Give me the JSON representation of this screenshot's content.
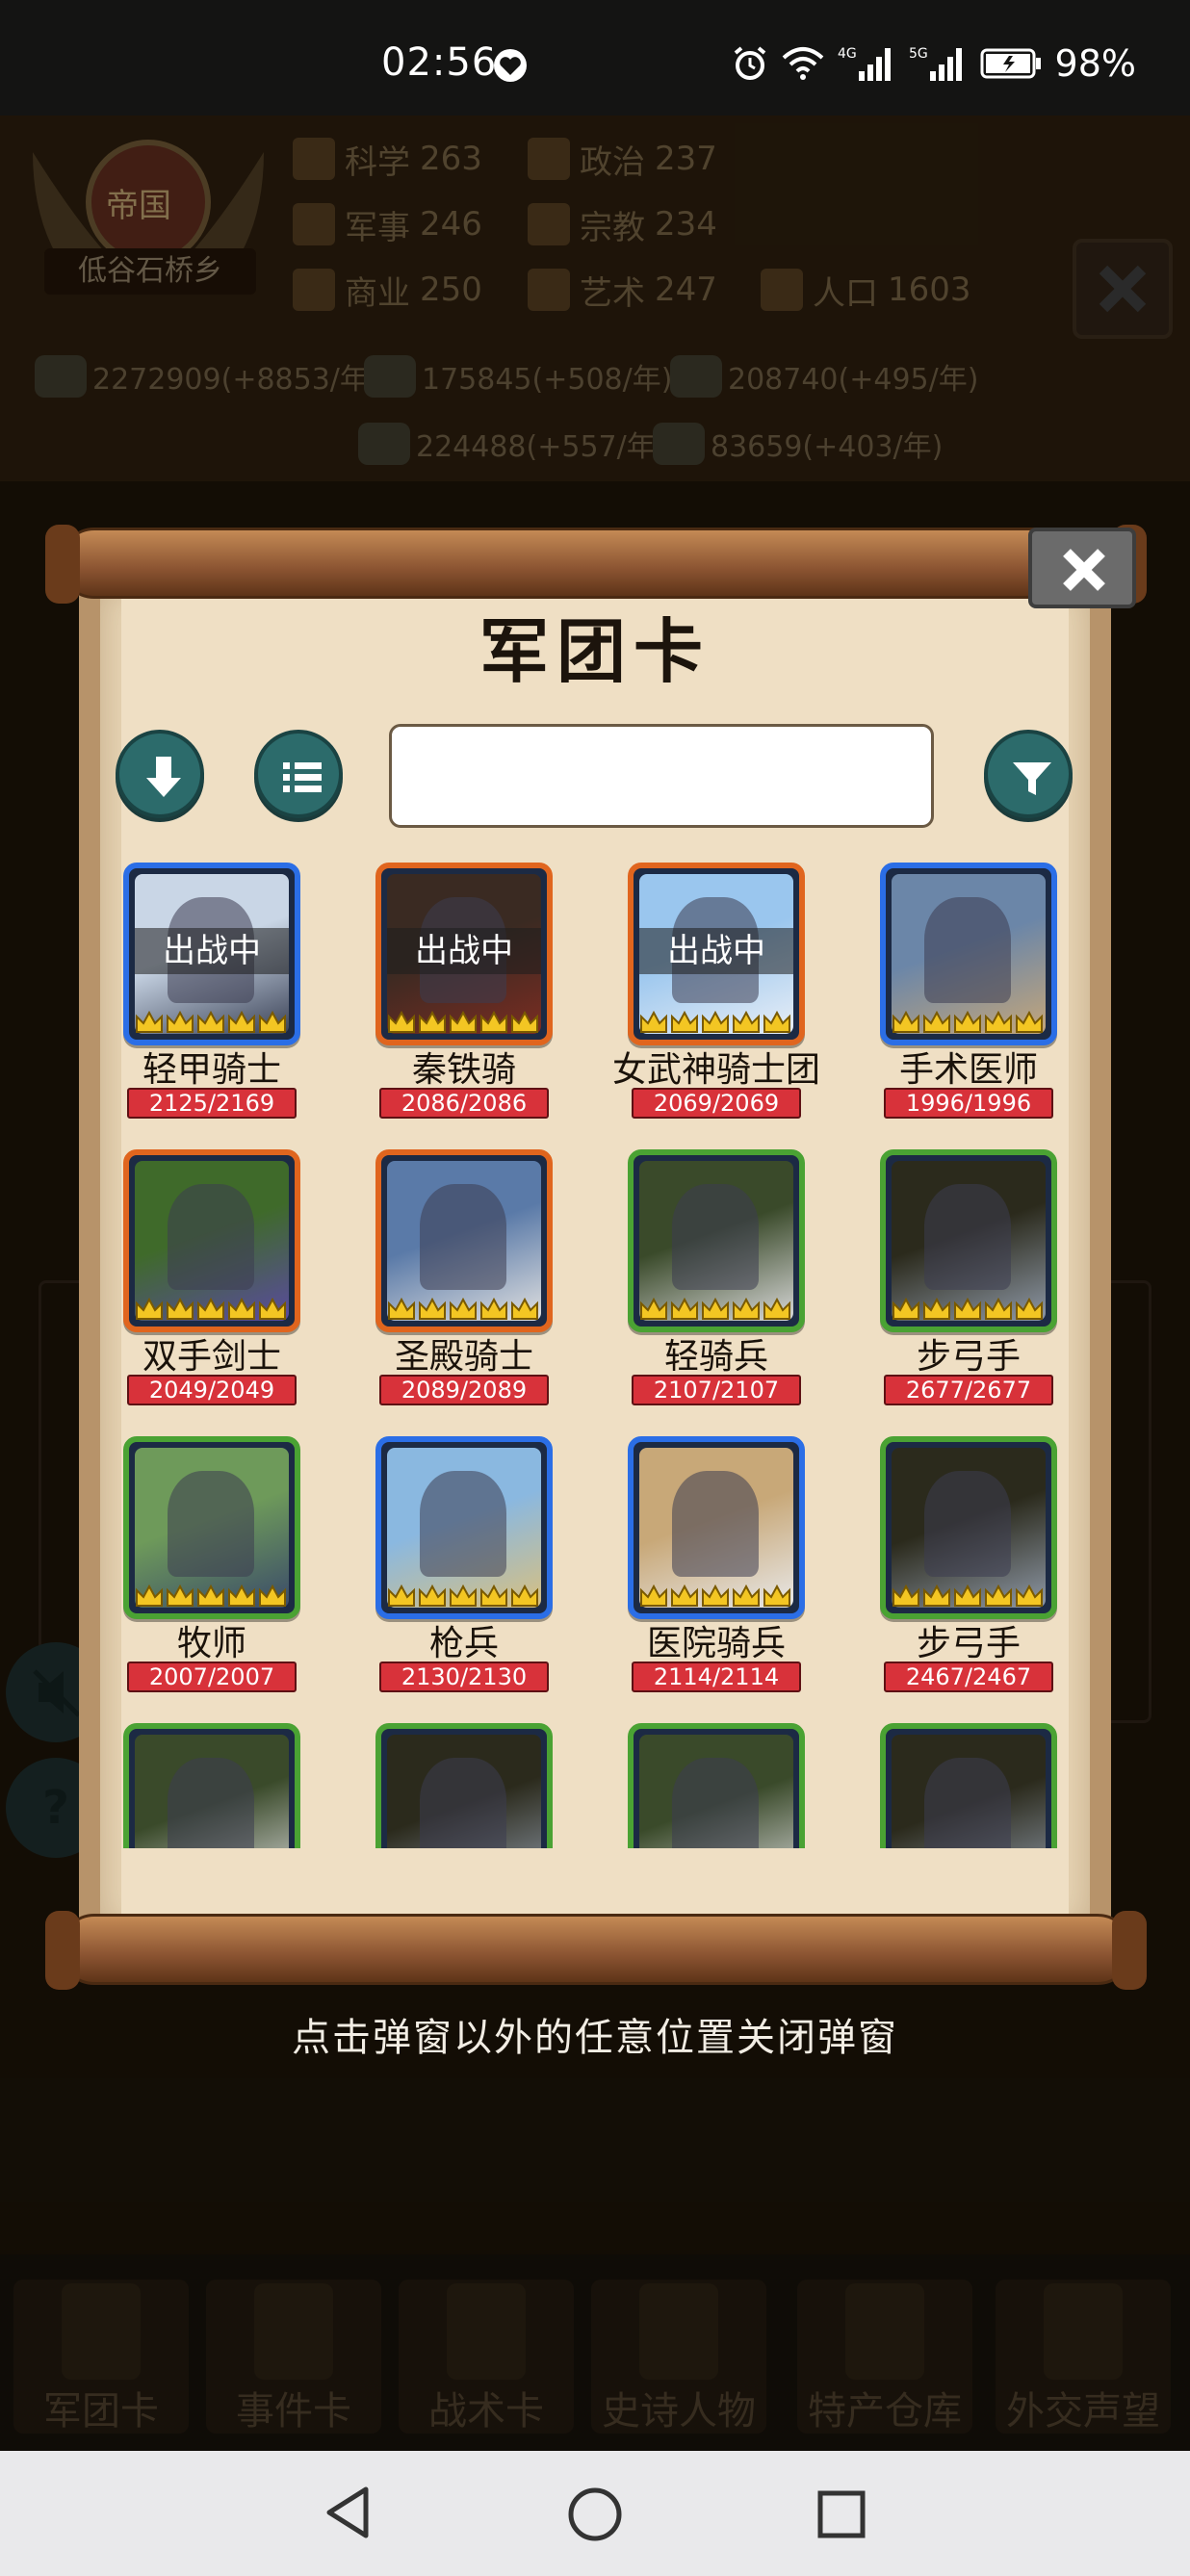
{
  "status_bar": {
    "time": "02:56",
    "net_4g": "4G",
    "net_5g": "5G",
    "battery": "98%"
  },
  "hud": {
    "empire_title": "帝国",
    "location": "低谷石桥乡",
    "stats": [
      {
        "label": "科学",
        "value": "263"
      },
      {
        "label": "政治",
        "value": "237"
      },
      {
        "label": "军事",
        "value": "246"
      },
      {
        "label": "宗教",
        "value": "234"
      },
      {
        "label": "商业",
        "value": "250"
      },
      {
        "label": "艺术",
        "value": "247"
      },
      {
        "label": "人口",
        "value": "1603"
      }
    ],
    "resources": [
      "2272909(+8853/年)",
      "175845(+508/年)",
      "208740(+495/年)",
      "224488(+557/年)",
      "83659(+403/年)"
    ]
  },
  "popup": {
    "title": "军团卡",
    "search_placeholder": "",
    "cards": [
      {
        "name": "轻甲骑士",
        "hp": "2125/2169",
        "rarity": "blue",
        "deployed": true,
        "art": "knight-on-horse"
      },
      {
        "name": "秦铁骑",
        "hp": "2086/2086",
        "rarity": "orange",
        "deployed": true,
        "art": "armored-cavalry"
      },
      {
        "name": "女武神骑士团",
        "hp": "2069/2069",
        "rarity": "orange",
        "deployed": true,
        "art": "valkyrie-rider"
      },
      {
        "name": "手术医师",
        "hp": "1996/1996",
        "rarity": "blue",
        "deployed": false,
        "art": "surgeon"
      },
      {
        "name": "双手剑士",
        "hp": "2049/2049",
        "rarity": "orange",
        "deployed": false,
        "art": "two-handed-swordsman"
      },
      {
        "name": "圣殿骑士",
        "hp": "2089/2089",
        "rarity": "orange",
        "deployed": false,
        "art": "templar-knight"
      },
      {
        "name": "轻骑兵",
        "hp": "2107/2107",
        "rarity": "green",
        "deployed": false,
        "art": "light-cavalry"
      },
      {
        "name": "步弓手",
        "hp": "2677/2677",
        "rarity": "green",
        "deployed": false,
        "art": "archer"
      },
      {
        "name": "牧师",
        "hp": "2007/2007",
        "rarity": "green",
        "deployed": false,
        "art": "priest"
      },
      {
        "name": "枪兵",
        "hp": "2130/2130",
        "rarity": "blue",
        "deployed": false,
        "art": "spearman"
      },
      {
        "name": "医院骑兵",
        "hp": "2114/2114",
        "rarity": "blue",
        "deployed": false,
        "art": "hospitaller"
      },
      {
        "name": "步弓手",
        "hp": "2467/2467",
        "rarity": "green",
        "deployed": false,
        "art": "archer"
      },
      {
        "name": "",
        "hp": "",
        "rarity": "green",
        "deployed": false,
        "art": "light-cavalry"
      },
      {
        "name": "",
        "hp": "",
        "rarity": "green",
        "deployed": false,
        "art": "archer"
      },
      {
        "name": "",
        "hp": "",
        "rarity": "green",
        "deployed": false,
        "art": "light-cavalry"
      },
      {
        "name": "",
        "hp": "",
        "rarity": "green",
        "deployed": false,
        "art": "archer"
      }
    ],
    "deployed_label": "出战中"
  },
  "hint": "点击弹窗以外的任意位置关闭弹窗",
  "side_buttons": [
    "?"
  ],
  "bottom_nav": [
    "军团卡",
    "事件卡",
    "战术卡",
    "史诗人物",
    "特产仓库",
    "外交声望"
  ],
  "colors": {
    "rarity_blue": "#2b6ee6",
    "rarity_orange": "#e0651e",
    "rarity_green": "#4aa233",
    "hp_bar": "#d8323a",
    "button_teal": "#2c6b6b"
  }
}
